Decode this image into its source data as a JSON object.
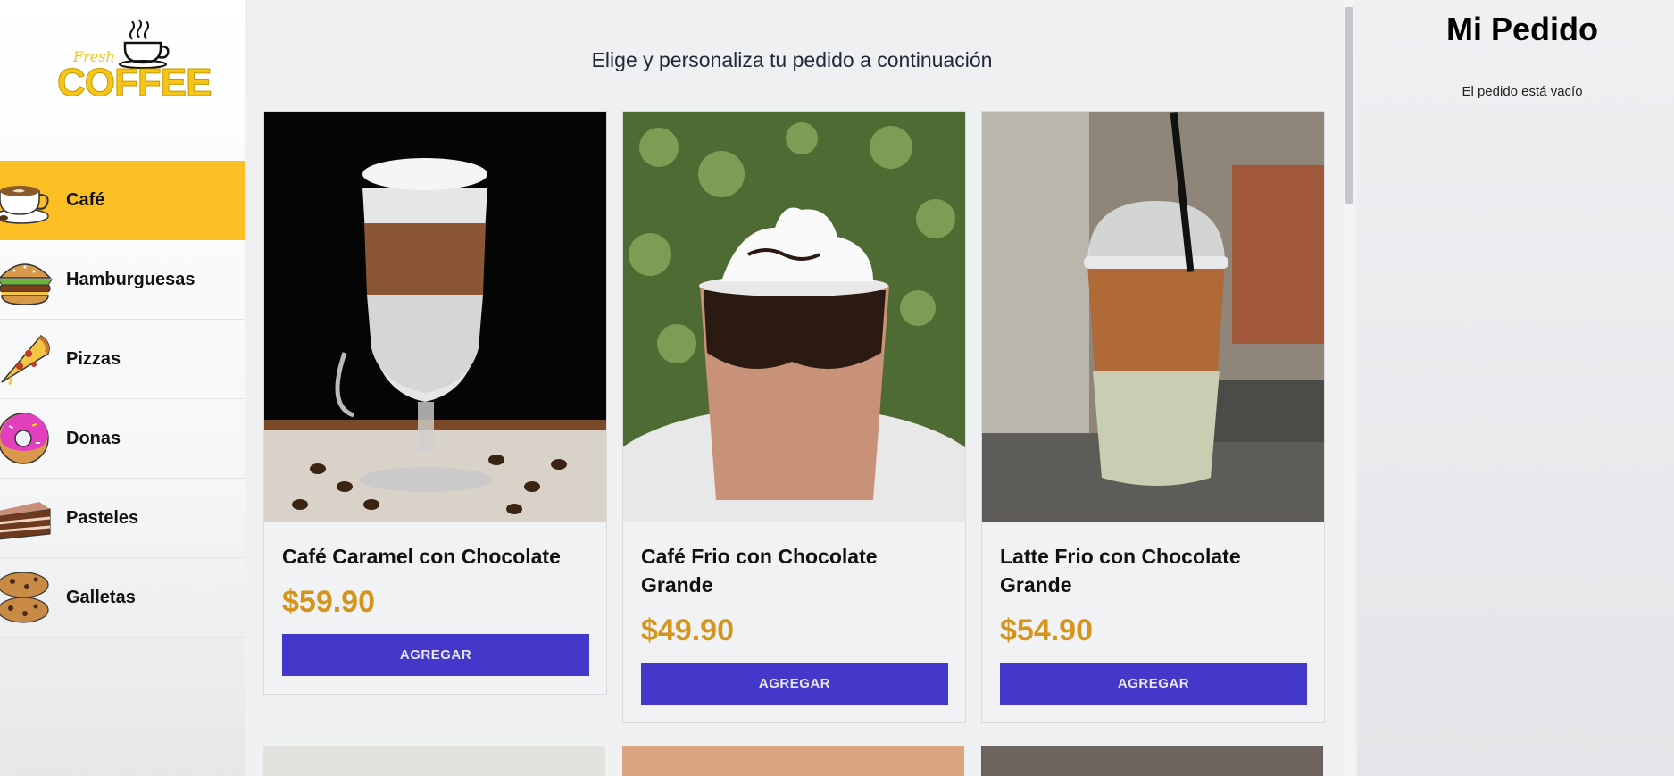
{
  "logo": {
    "small_text": "Fresh",
    "big_text": "COFFEE"
  },
  "colors": {
    "accent": "#fbbf24",
    "price": "#d4941b",
    "button": "#4338ca"
  },
  "sidebar": {
    "items": [
      {
        "label": "Café",
        "icon": "coffee-cup-icon",
        "active": true
      },
      {
        "label": "Hamburguesas",
        "icon": "burger-icon",
        "active": false
      },
      {
        "label": "Pizzas",
        "icon": "pizza-icon",
        "active": false
      },
      {
        "label": "Donas",
        "icon": "donut-icon",
        "active": false
      },
      {
        "label": "Pasteles",
        "icon": "cake-icon",
        "active": false
      },
      {
        "label": "Galletas",
        "icon": "cookie-icon",
        "active": false
      }
    ]
  },
  "main": {
    "subtitle": "Elige y personaliza tu pedido a continuación",
    "products": [
      {
        "name": "Café Caramel con Chocolate",
        "price": "$59.90",
        "button": "AGREGAR",
        "image": "layered-latte-glass"
      },
      {
        "name": "Café Frio con Chocolate Grande",
        "price": "$49.90",
        "button": "AGREGAR",
        "image": "iced-mocha-whipped-cream"
      },
      {
        "name": "Latte Frio con Chocolate Grande",
        "price": "$54.90",
        "button": "AGREGAR",
        "image": "iced-latte-dome-lid"
      }
    ]
  },
  "order": {
    "title": "Mi Pedido",
    "empty_text": "El pedido está vacío"
  }
}
